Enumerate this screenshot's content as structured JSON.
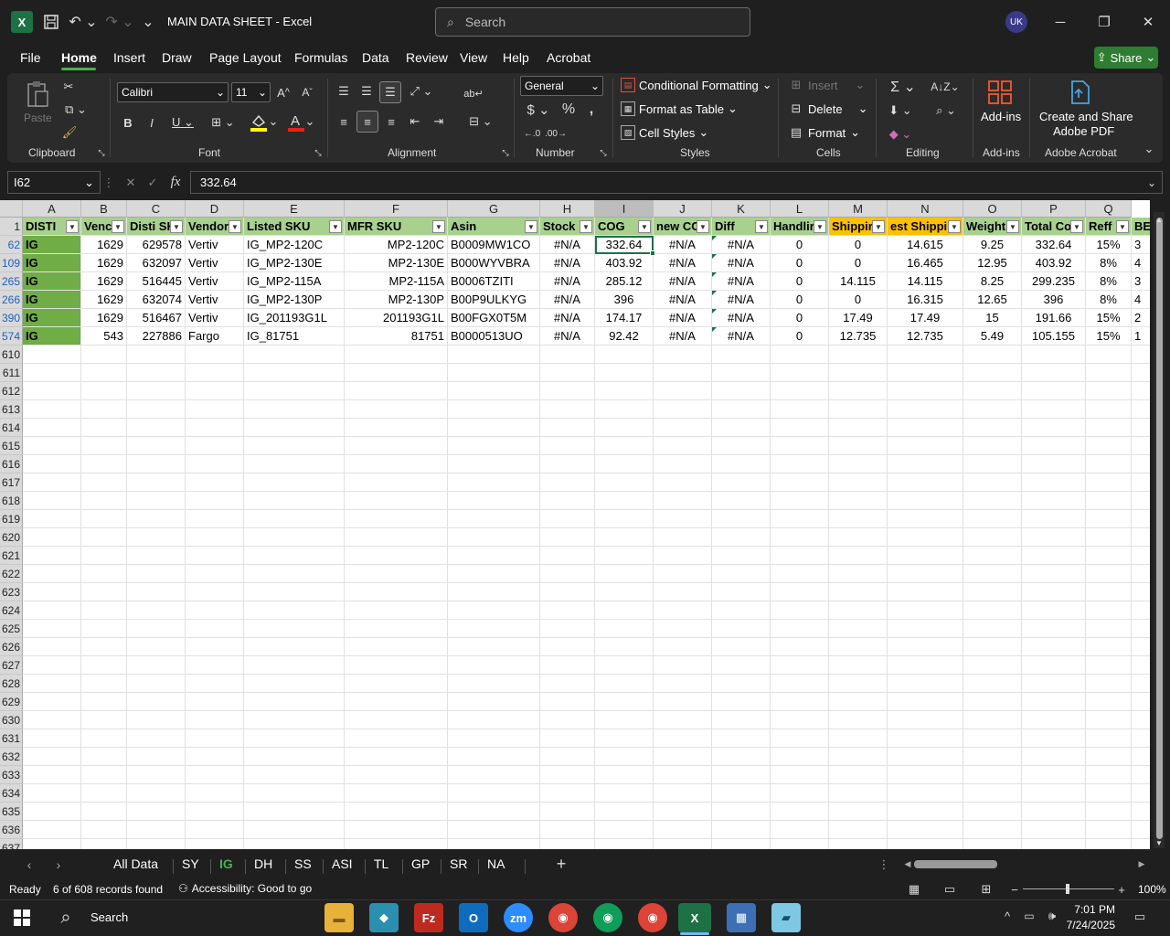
{
  "window": {
    "title": "MAIN DATA SHEET  -  Excel",
    "search_placeholder": "Search",
    "user_initials": "UK"
  },
  "menu": {
    "tabs": [
      "File",
      "Home",
      "Insert",
      "Draw",
      "Page Layout",
      "Formulas",
      "Data",
      "Review",
      "View",
      "Help",
      "Acrobat"
    ],
    "active": "Home",
    "share_label": "Share"
  },
  "ribbon": {
    "clipboard": {
      "paste": "Paste",
      "label": "Clipboard"
    },
    "font": {
      "name": "Calibri",
      "size": "11",
      "label": "Font"
    },
    "alignment": {
      "label": "Alignment"
    },
    "number": {
      "format": "General",
      "label": "Number"
    },
    "styles": {
      "conditional": "Conditional Formatting",
      "format_table": "Format as Table",
      "cell_styles": "Cell Styles",
      "label": "Styles"
    },
    "cells": {
      "insert": "Insert",
      "delete": "Delete",
      "format": "Format",
      "label": "Cells"
    },
    "editing": {
      "label": "Editing"
    },
    "addins": {
      "button": "Add-ins",
      "label": "Add-ins"
    },
    "acrobat": {
      "line1": "Create and Share",
      "line2": "Adobe PDF",
      "label": "Adobe Acrobat"
    }
  },
  "formula_bar": {
    "name_box": "I62",
    "fx": "fx",
    "value": "332.64"
  },
  "columns": [
    "A",
    "B",
    "C",
    "D",
    "E",
    "F",
    "G",
    "H",
    "I",
    "J",
    "K",
    "L",
    "M",
    "N",
    "O",
    "P",
    "Q"
  ],
  "header_row": {
    "row_number": "1",
    "cells": [
      "DISTI",
      "Venc",
      "Disti SK",
      "Vendor",
      "Listed SKU",
      "MFR SKU",
      "Asin",
      "Stock",
      "COG",
      "new CC",
      "Diff",
      "Handlir",
      "Shippir",
      "est Shippi",
      "Weight",
      "Total Co",
      "Reff",
      "BE"
    ]
  },
  "rows": [
    {
      "num": "62",
      "cells": [
        "IG",
        "1629",
        "629578",
        "Vertiv",
        "IG_MP2-120C",
        "MP2-120C",
        "B0009MW1CO",
        "#N/A",
        "332.64",
        "#N/A",
        "#N/A",
        "0",
        "0",
        "14.615",
        "9.25",
        "332.64",
        "15%",
        "3"
      ]
    },
    {
      "num": "109",
      "cells": [
        "IG",
        "1629",
        "632097",
        "Vertiv",
        "IG_MP2-130E",
        "MP2-130E",
        "B000WYVBRA",
        "#N/A",
        "403.92",
        "#N/A",
        "#N/A",
        "0",
        "0",
        "16.465",
        "12.95",
        "403.92",
        "8%",
        "4"
      ]
    },
    {
      "num": "265",
      "cells": [
        "IG",
        "1629",
        "516445",
        "Vertiv",
        "IG_MP2-115A",
        "MP2-115A",
        "B0006TZITI",
        "#N/A",
        "285.12",
        "#N/A",
        "#N/A",
        "0",
        "14.115",
        "14.115",
        "8.25",
        "299.235",
        "8%",
        "3"
      ]
    },
    {
      "num": "266",
      "cells": [
        "IG",
        "1629",
        "632074",
        "Vertiv",
        "IG_MP2-130P",
        "MP2-130P",
        "B00P9ULKYG",
        "#N/A",
        "396",
        "#N/A",
        "#N/A",
        "0",
        "0",
        "16.315",
        "12.65",
        "396",
        "8%",
        "4"
      ]
    },
    {
      "num": "390",
      "cells": [
        "IG",
        "1629",
        "516467",
        "Vertiv",
        "IG_201193G1L",
        "201193G1L",
        "B00FGX0T5M",
        "#N/A",
        "174.17",
        "#N/A",
        "#N/A",
        "0",
        "17.49",
        "17.49",
        "15",
        "191.66",
        "15%",
        "2"
      ]
    },
    {
      "num": "574",
      "cells": [
        "IG",
        "543",
        "227886",
        "Fargo",
        "IG_81751",
        "81751",
        "B0000513UO",
        "#N/A",
        "92.42",
        "#N/A",
        "#N/A",
        "0",
        "12.735",
        "12.735",
        "5.49",
        "105.155",
        "15%",
        "1"
      ]
    }
  ],
  "empty_rows": [
    "610",
    "611",
    "612",
    "613",
    "614",
    "615",
    "616",
    "617",
    "618",
    "619",
    "620",
    "621",
    "622",
    "623",
    "624",
    "625",
    "626",
    "627",
    "628",
    "629",
    "630",
    "631",
    "632",
    "633",
    "634",
    "635",
    "636",
    "637"
  ],
  "sheet_tabs": [
    "All Data",
    "SY",
    "IG",
    "DH",
    "SS",
    "ASI",
    "TL",
    "GP",
    "SR",
    "NA"
  ],
  "active_sheet": "IG",
  "status": {
    "ready": "Ready",
    "records": "6 of 608 records found",
    "accessibility": "Accessibility: Good to go",
    "zoom": "100%"
  },
  "taskbar": {
    "search": "Search",
    "time": "7:01 PM",
    "date": "7/24/2025"
  }
}
